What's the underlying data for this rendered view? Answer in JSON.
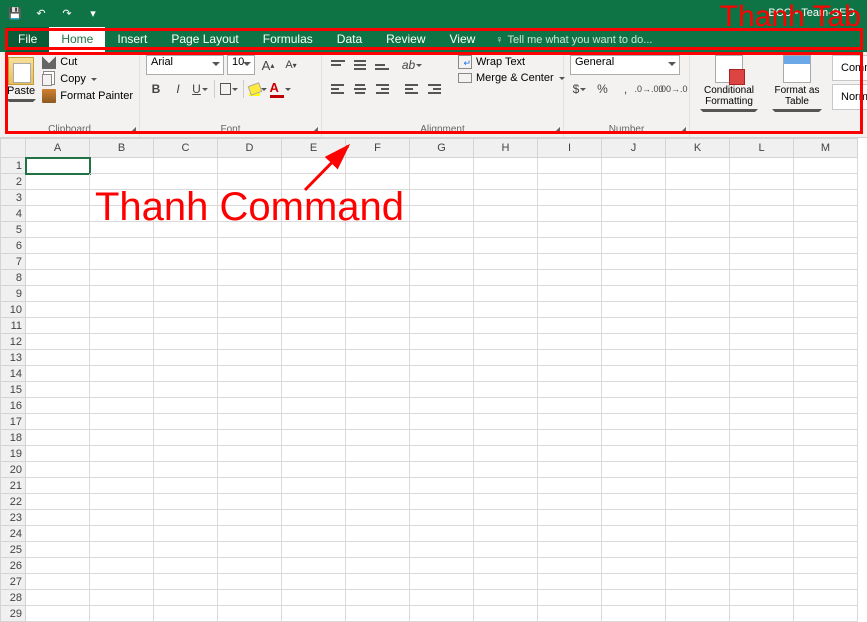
{
  "title": "BCC - Team-SEO",
  "annotations": {
    "tab": "Thanh Tab",
    "command": "Thanh Command"
  },
  "tabs": [
    "File",
    "Home",
    "Insert",
    "Page Layout",
    "Formulas",
    "Data",
    "Review",
    "View"
  ],
  "active_tab": "Home",
  "tellme_placeholder": "Tell me what you want to do...",
  "clipboard": {
    "paste": "Paste",
    "cut": "Cut",
    "copy": "Copy",
    "format_painter": "Format Painter",
    "group": "Clipboard"
  },
  "font": {
    "name": "Arial",
    "size": "10",
    "group": "Font",
    "increase": "A",
    "decrease": "A",
    "bold": "B",
    "italic": "I",
    "underline": "U"
  },
  "alignment": {
    "wrap": "Wrap Text",
    "merge": "Merge & Center",
    "group": "Alignment"
  },
  "number": {
    "format": "General",
    "group": "Number",
    "currency": "$",
    "percent": "%",
    "comma": ",",
    "inc": "",
    "dec": ""
  },
  "styles": {
    "conditional": "Conditional Formatting",
    "format_table": "Format as Table",
    "normal": "Norma",
    "comm": "Comm"
  },
  "grid": {
    "cols": [
      "A",
      "B",
      "C",
      "D",
      "E",
      "F",
      "G",
      "H",
      "I",
      "J",
      "K",
      "L",
      "M"
    ],
    "row_count": 29,
    "selected": "A1"
  }
}
